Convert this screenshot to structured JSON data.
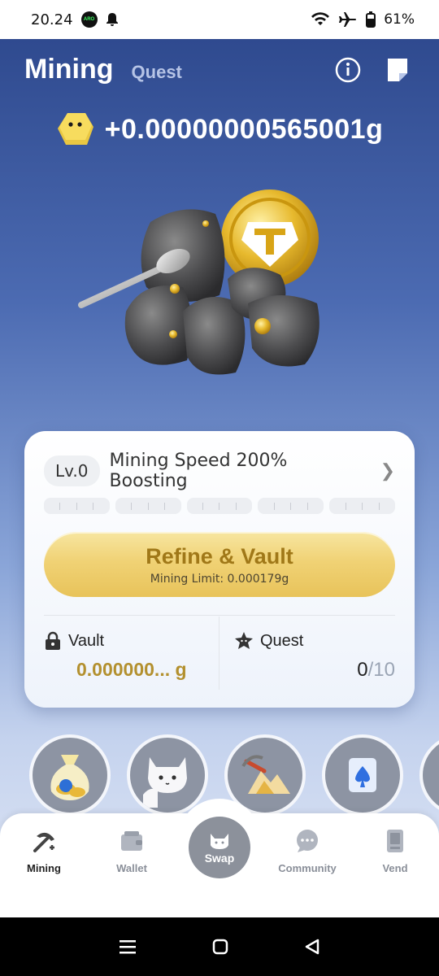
{
  "status_bar": {
    "time": "20.24",
    "battery": "61%",
    "app_badge": "ARO"
  },
  "header": {
    "title": "Mining",
    "quest_tab": "Quest"
  },
  "balance": {
    "text": "+0.00000000565001g"
  },
  "card": {
    "level": "Lv.0",
    "boost_text": "Mining Speed 200% Boosting",
    "progress_fraction": 0,
    "refine_button": {
      "label": "Refine & Vault",
      "sub": "Mining Limit: 0.000179g"
    },
    "vault": {
      "label": "Vault",
      "value": "0.000000... g"
    },
    "quest": {
      "label": "Quest",
      "current": "0",
      "total": "/10"
    }
  },
  "shortcuts": [
    "money-bag-icon",
    "mascot-icon",
    "pickaxe-mountain-icon",
    "spade-card-icon"
  ],
  "nav": {
    "items": [
      {
        "label": "Mining",
        "icon": "pickaxe-icon",
        "active": true
      },
      {
        "label": "Wallet",
        "icon": "wallet-icon",
        "active": false
      },
      {
        "label": "Swap",
        "icon": "cat-icon",
        "active": false
      },
      {
        "label": "Community",
        "icon": "chat-icon",
        "active": false
      },
      {
        "label": "Vend",
        "icon": "vending-icon",
        "active": false
      }
    ]
  },
  "colors": {
    "accent_gold": "#b3902f",
    "bg_top": "#2f4a8f",
    "button_gold": "#f0d275"
  }
}
